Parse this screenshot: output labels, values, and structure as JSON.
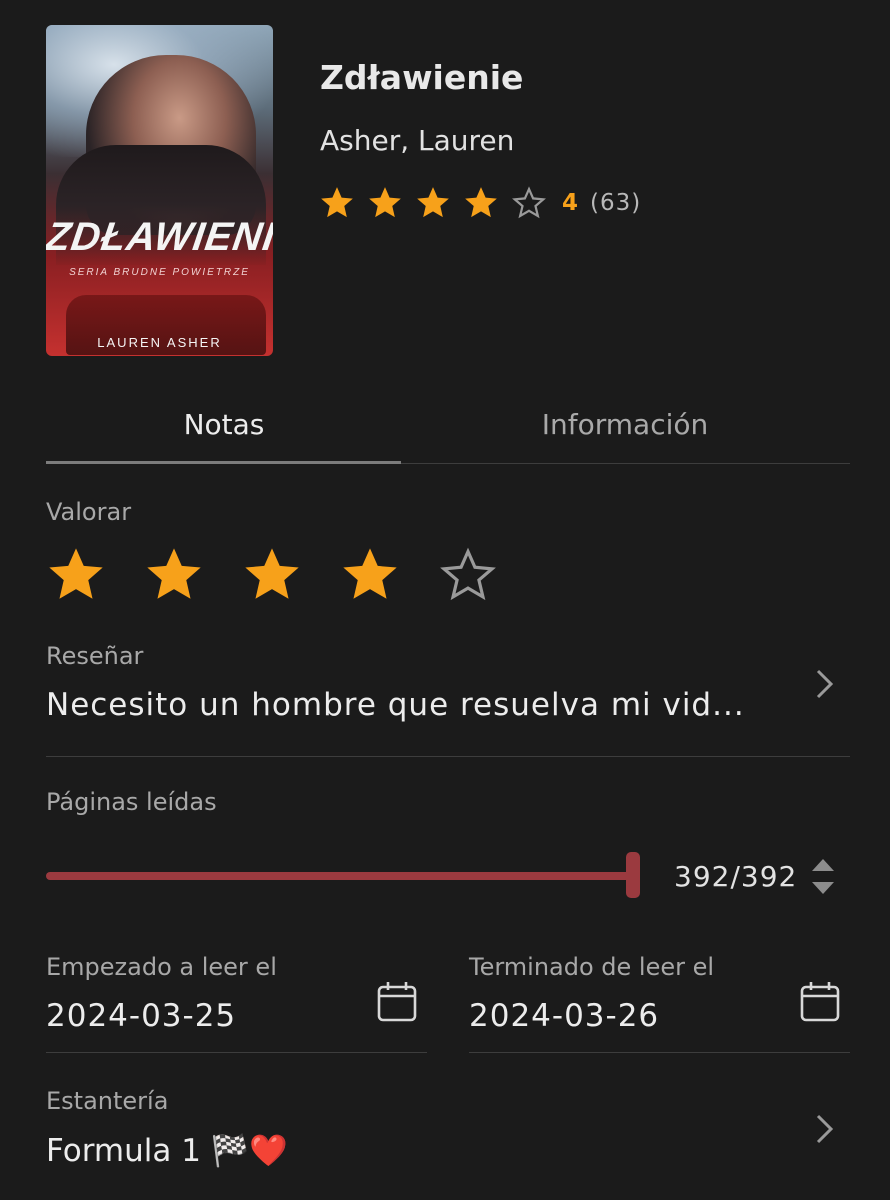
{
  "book": {
    "title": "Zdławienie",
    "author": "Asher, Lauren",
    "cover": {
      "title": "ZDŁAWIENIE",
      "series": "SERIA BRUDNE POWIETRZE",
      "author": "LAUREN ASHER"
    },
    "rating_average": "4",
    "rating_count": "(63)",
    "rating_stars_filled": 4,
    "rating_stars_total": 5
  },
  "tabs": [
    {
      "label": "Notas",
      "active": true
    },
    {
      "label": "Información",
      "active": false
    }
  ],
  "notes": {
    "rate": {
      "label": "Valorar",
      "stars_filled": 4,
      "stars_total": 5
    },
    "review": {
      "label": "Reseñar",
      "value": "Necesito un hombre que resuelva mi vid..."
    },
    "pages": {
      "label": "Páginas leídas",
      "value": "392/392",
      "read": 392,
      "total": 392
    },
    "started": {
      "label": "Empezado a leer el",
      "value": "2024-03-25"
    },
    "finished": {
      "label": "Terminado de leer el",
      "value": "2024-03-26"
    },
    "shelf": {
      "label": "Estantería",
      "value": "Formula 1 🏁❤️"
    }
  },
  "colors": {
    "background": "#1b1b1b",
    "star": "#f7a11a",
    "accent": "#9b3a3f",
    "muted": "#a8a8a8"
  },
  "icons": {
    "star": "star-icon",
    "chevron": "chevron-right-icon",
    "calendar": "calendar-icon",
    "stepper": "stepper-icon"
  }
}
